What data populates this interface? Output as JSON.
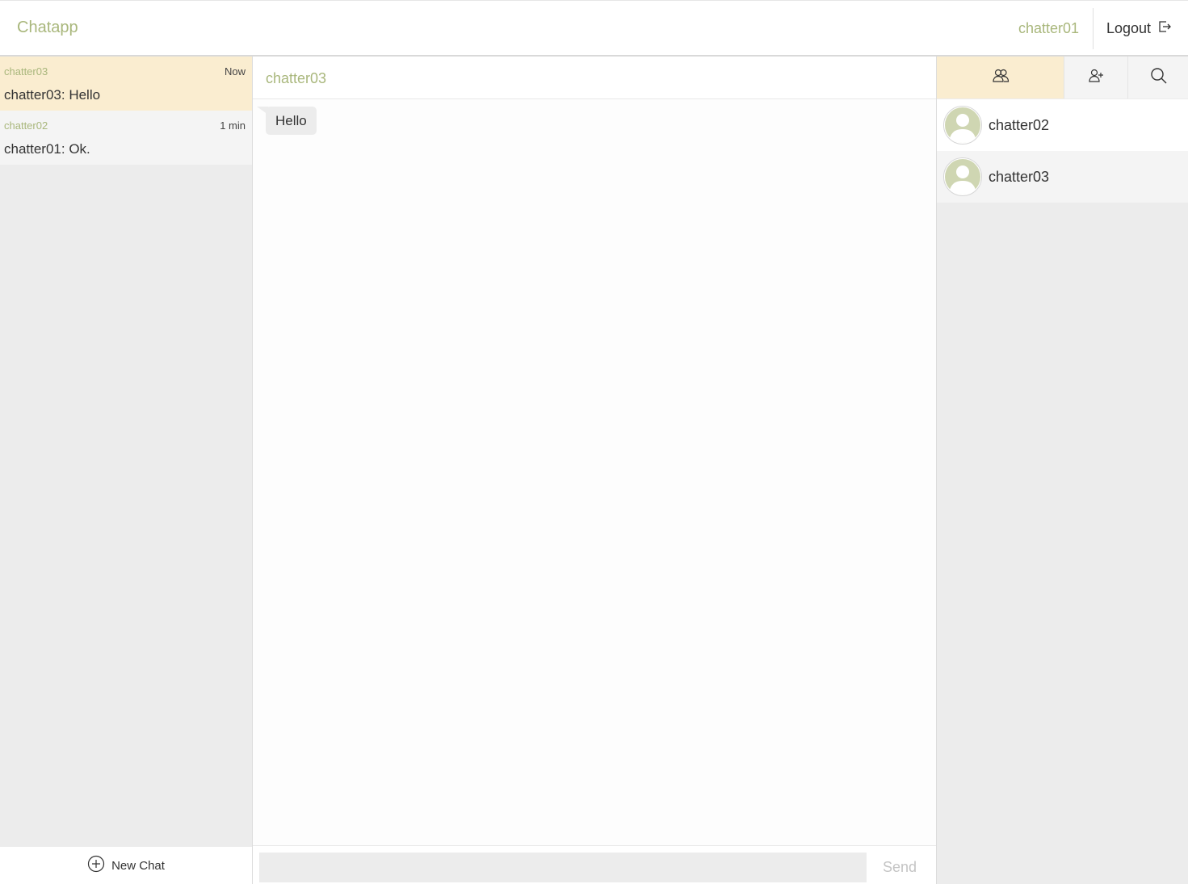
{
  "header": {
    "brand": "Chatapp",
    "current_user": "chatter01",
    "logout_label": "Logout"
  },
  "conversations": [
    {
      "name": "chatter03",
      "time": "Now",
      "last_message": "chatter03: Hello",
      "active": true
    },
    {
      "name": "chatter02",
      "time": "1 min",
      "last_message": "chatter01: Ok.",
      "active": false
    }
  ],
  "new_chat_label": "New Chat",
  "chat": {
    "title": "chatter03",
    "messages": [
      {
        "text": "Hello",
        "from": "chatter03"
      }
    ],
    "input_value": "",
    "send_label": "Send"
  },
  "sidebar": {
    "tabs": [
      {
        "icon": "contacts-icon",
        "active": true
      },
      {
        "icon": "add-user-icon",
        "active": false
      },
      {
        "icon": "search-icon",
        "active": false
      }
    ],
    "contacts": [
      {
        "name": "chatter02"
      },
      {
        "name": "chatter03"
      }
    ]
  },
  "colors": {
    "accent": "#a9b77c",
    "active_bg": "#faedd0",
    "panel_bg": "#ececec"
  }
}
